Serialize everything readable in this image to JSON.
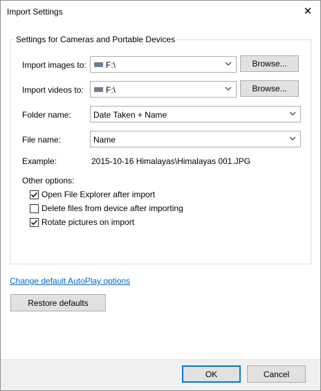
{
  "window": {
    "title": "Import Settings"
  },
  "group": {
    "title": "Settings for Cameras and Portable Devices",
    "import_images": {
      "label": "Import images to:",
      "value": "F:\\",
      "browse": "Browse..."
    },
    "import_videos": {
      "label": "Import videos to:",
      "value": "F:\\",
      "browse": "Browse..."
    },
    "folder_name": {
      "label": "Folder name:",
      "value": "Date Taken + Name"
    },
    "file_name": {
      "label": "File name:",
      "value": "Name"
    },
    "example": {
      "label": "Example:",
      "value": "2015-10-16 Himalayas\\Himalayas 001.JPG"
    },
    "other_options": {
      "label": "Other options:",
      "items": [
        {
          "label": "Open File Explorer after import",
          "checked": true
        },
        {
          "label": "Delete files from device after importing",
          "checked": false
        },
        {
          "label": "Rotate pictures on import",
          "checked": true
        }
      ]
    }
  },
  "autoplay_link": "Change default AutoPlay options",
  "restore_defaults": "Restore defaults",
  "ok": "OK",
  "cancel": "Cancel",
  "icons": {
    "close": "close-icon",
    "drive": "drive-icon",
    "dropdown": "chevron-down-icon",
    "check": "checkmark-icon"
  },
  "colors": {
    "link": "#0066cc",
    "default_button_border": "#0078d7",
    "button_face": "#e1e1e1",
    "footer": "#f0f0f0"
  }
}
